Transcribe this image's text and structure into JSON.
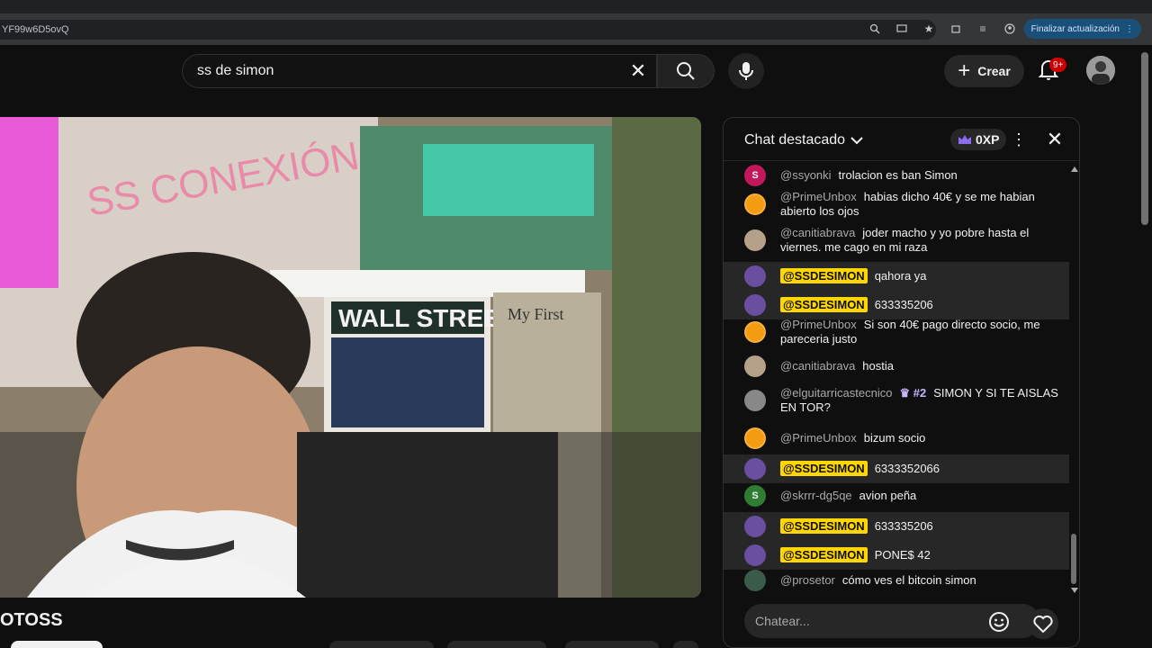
{
  "browser": {
    "url": "YF99w6D5ovQ",
    "update_label": "Finalizar actualización"
  },
  "search": {
    "query": "ss de simon"
  },
  "header": {
    "create_label": "Crear",
    "notifications_badge": "9+"
  },
  "video": {
    "title_fragment": "OTOSS",
    "wall_street_text": "WALL STREET",
    "wall_text": "SS CONEXIÓN",
    "sign_text": "My First"
  },
  "chat": {
    "title": "Chat destacado",
    "xp_label": "0XP",
    "input_placeholder": "Chatear...",
    "messages": [
      {
        "author": "@ssyonki",
        "text": "trolacion es ban Simon",
        "owner": false,
        "avatar": "S",
        "avatar_color": "#c2185b"
      },
      {
        "author": "@PrimeUnbox",
        "text": "habias dicho 40€ y se me habian abierto los ojos",
        "owner": false,
        "avatar": "prime",
        "avatar_color": "#f39c12"
      },
      {
        "author": "@canitiabrava",
        "text": "joder macho y yo pobre hasta el viernes. me cago en mi raza",
        "owner": false,
        "avatar": "",
        "avatar_color": "#b5a08a"
      },
      {
        "author": "@SSDESIMON",
        "text": "qahora ya",
        "owner": true,
        "avatar": "",
        "avatar_color": "#6a4fa0"
      },
      {
        "author": "@SSDESIMON",
        "text": "633335206",
        "owner": true,
        "avatar": "",
        "avatar_color": "#6a4fa0"
      },
      {
        "author": "@PrimeUnbox",
        "text": "Si son 40€ pago directo socio, me pareceria justo",
        "owner": false,
        "avatar": "prime",
        "avatar_color": "#f39c12"
      },
      {
        "author": "@canitiabrava",
        "text": "hostia",
        "owner": false,
        "avatar": "",
        "avatar_color": "#b5a08a"
      },
      {
        "author": "@elguitarricastecnico",
        "rank": "#2",
        "text": "SIMON Y SI TE AISLAS EN TOR?",
        "owner": false,
        "avatar": "",
        "avatar_color": "#888888"
      },
      {
        "author": "@PrimeUnbox",
        "text": "bizum socio",
        "owner": false,
        "avatar": "prime",
        "avatar_color": "#f39c12"
      },
      {
        "author": "@SSDESIMON",
        "text": "6333352066",
        "owner": true,
        "avatar": "",
        "avatar_color": "#6a4fa0"
      },
      {
        "author": "@skrrr-dg5qe",
        "text": "avion peña",
        "owner": false,
        "avatar": "S",
        "avatar_color": "#2e7d32"
      },
      {
        "author": "@SSDESIMON",
        "text": "633335206",
        "owner": true,
        "avatar": "",
        "avatar_color": "#6a4fa0"
      },
      {
        "author": "@SSDESIMON",
        "text": "PONE$ 42",
        "owner": true,
        "avatar": "",
        "avatar_color": "#6a4fa0"
      },
      {
        "author": "@prosetor",
        "text": "cómo ves el bitcoin simon",
        "owner": false,
        "avatar": "",
        "avatar_color": "#3a5a4a"
      }
    ]
  }
}
